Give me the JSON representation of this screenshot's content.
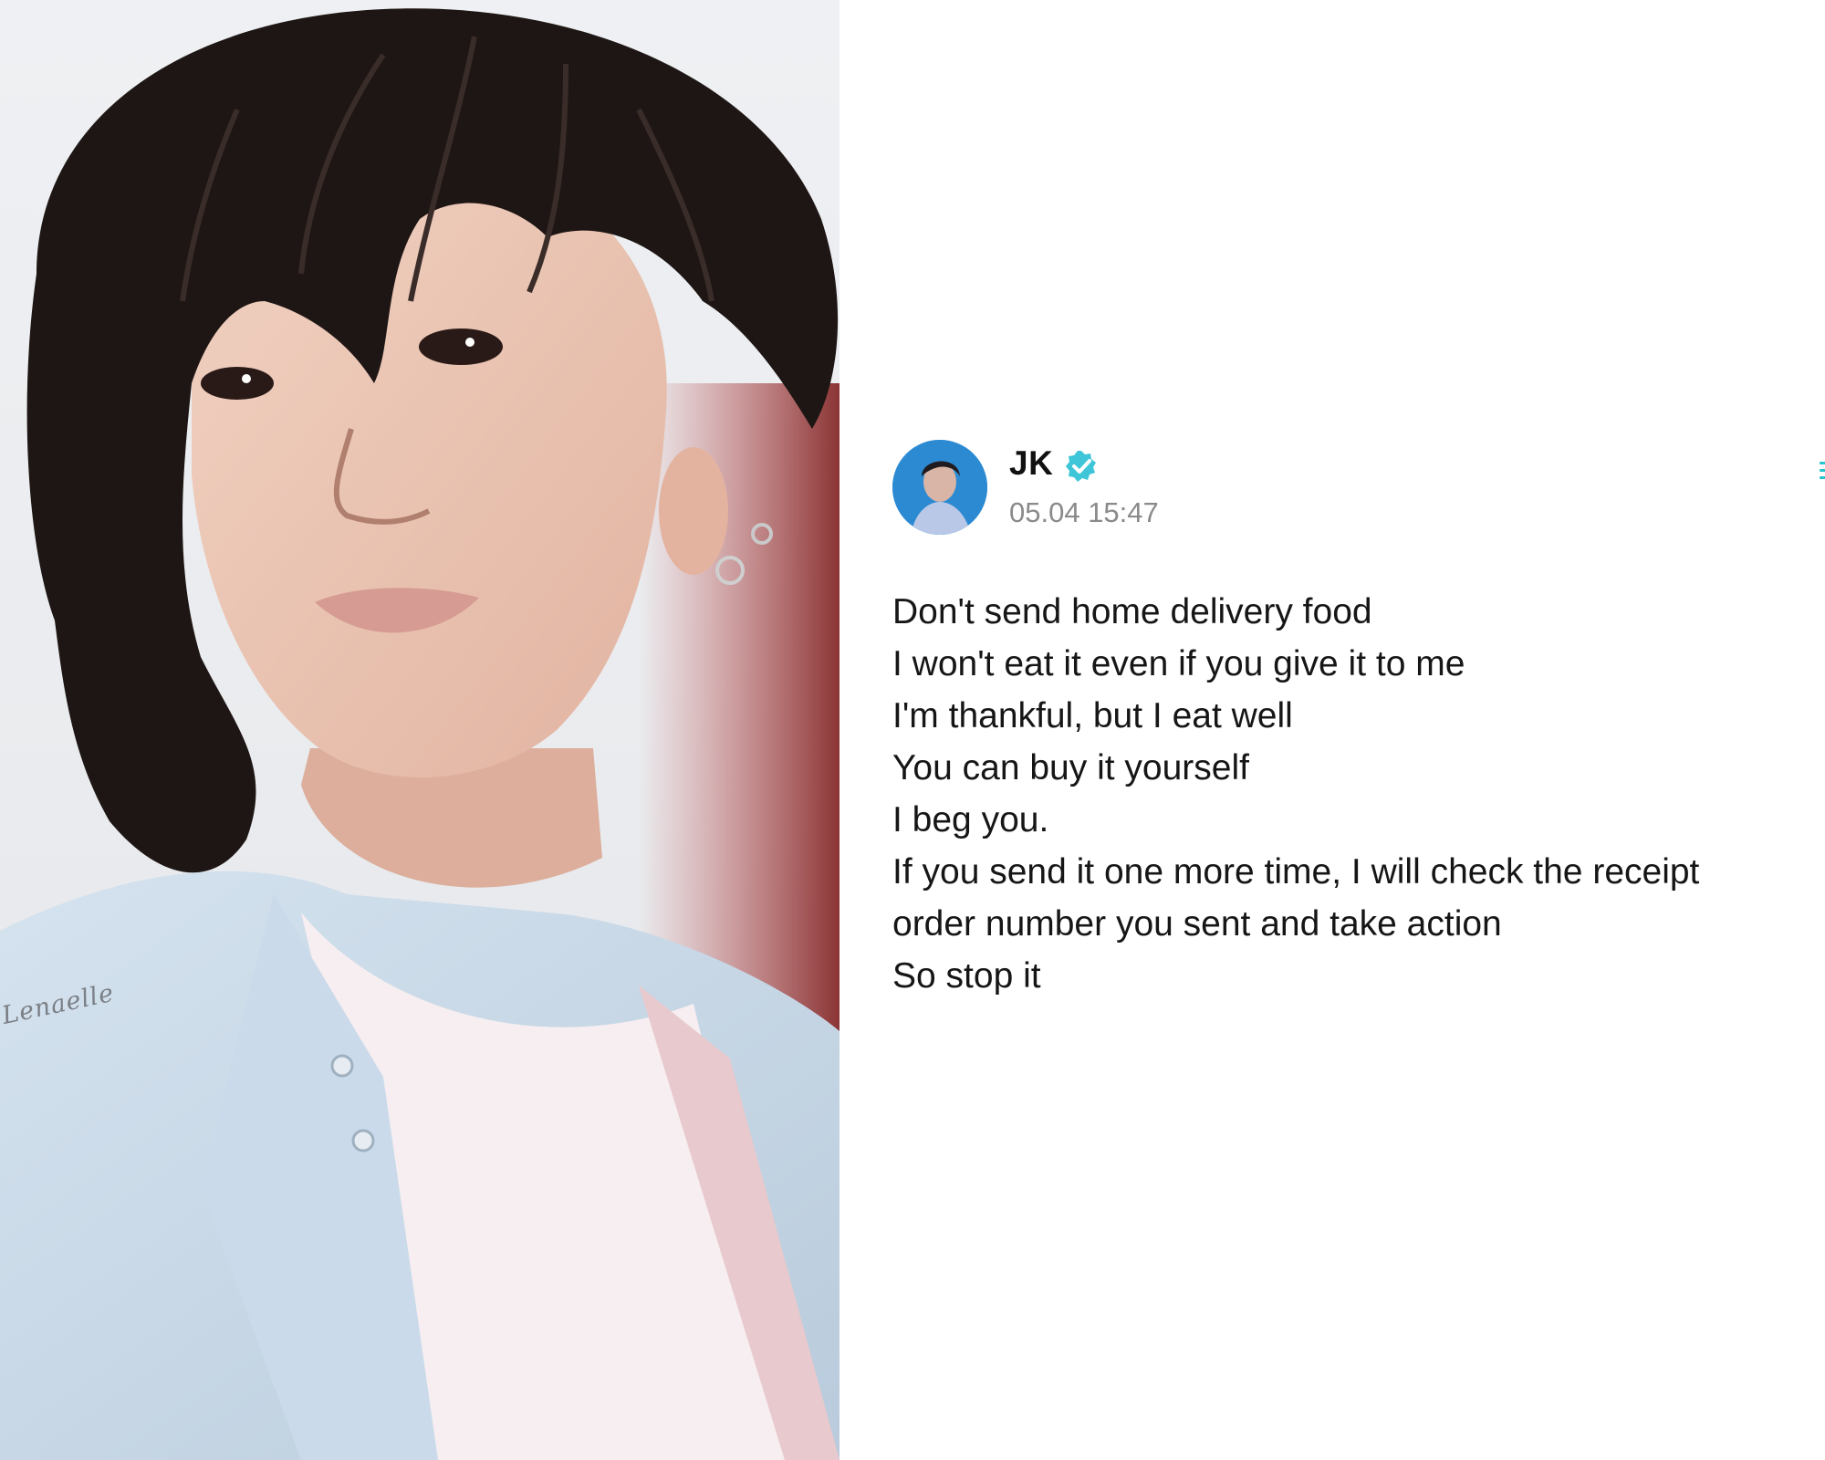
{
  "photo": {
    "watermark": "Lenaelle",
    "icon": "portrait-photo"
  },
  "post": {
    "author": {
      "name": "JK",
      "verified": true,
      "avatar_icon": "avatar",
      "verified_icon": "verified-badge-icon",
      "verified_color": "#3ec6d8"
    },
    "timestamp": "05.04 15:47",
    "more_icon": "more-options-icon",
    "lines": [
      "Don't send home delivery food",
      "I won't eat it even if you give it to me",
      "I'm thankful, but I eat well",
      "You can buy it yourself",
      "I beg you.",
      "If you send it one more time, I will check the receipt",
      "order number you sent and take action",
      "So stop it"
    ]
  },
  "colors": {
    "accent": "#29c5cf",
    "text": "#161616",
    "muted": "#8a8a8a",
    "background": "#ffffff"
  }
}
